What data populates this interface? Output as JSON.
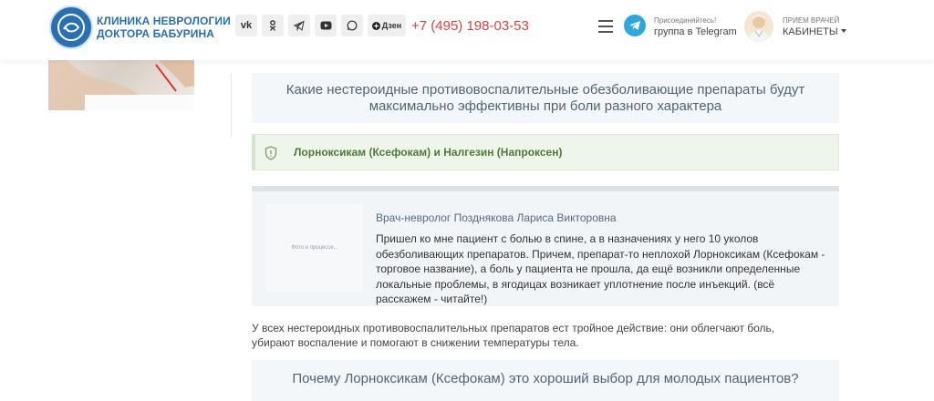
{
  "header": {
    "logo_line1": "Клиника неврологии",
    "logo_line2": "доктора Бабурина",
    "socials": [
      "vk-icon",
      "ok-icon",
      "telegram-icon",
      "youtube-icon",
      "whatsapp-icon",
      "dzen-icon"
    ],
    "dzen_label": "Дзен",
    "phone": "+7 (495) 198-03-53",
    "telegram_small": "Присоединяйтесь!",
    "telegram_main": "группа в Telegram",
    "reception_small": "Прием врачей",
    "reception_main": "КАБИНЕТЫ"
  },
  "main": {
    "question1": "Какие нестероидные противовоспалительные обезболивающие препараты будут максимально эффективны при боли разного характера",
    "answer": "Лорноксикам (Ксефокам) и Налгезин (Напроксен)",
    "quote": {
      "photo_placeholder": "Фото в процессе...",
      "author": "Врач-невролог Позднякова Лариса Викторовна",
      "text": "Пришел ко мне пациент с болью в спине, а в назначениях у него 10 уколов обезболивающих препаратов. Причем, препарат-то неплохой Лорноксикам (Ксефокам - торговое название), а боль у пациента не прошла, да ещё возникли определенные локальные проблемы, в ягодицах возникает уплотнение после инъекций. (всё расскажем - читайте!)"
    },
    "paragraph": "У всех нестероидных противовоспалительных препаратов ест тройное действие: они облегчают боль, убирают воспаление и помогают в снижении температуры тела.",
    "question2": "Почему Лорноксикам (Ксефокам) это хороший выбор для молодых пациентов?"
  },
  "colors": {
    "brand": "#2a6fb0",
    "phone": "#e03e3e",
    "answer_text": "#4e7a3a",
    "telegram": "#2ea6de"
  }
}
